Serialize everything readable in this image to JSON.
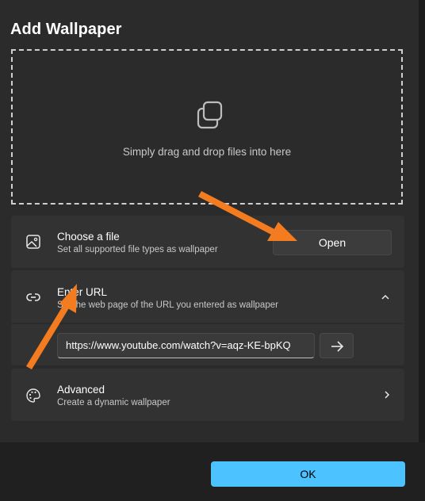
{
  "dialog": {
    "title": "Add Wallpaper",
    "dropzone_text": "Simply drag and drop files into here"
  },
  "choose_file": {
    "title": "Choose a file",
    "subtitle": "Set all supported file types as wallpaper",
    "button_label": "Open",
    "icon": "image-icon"
  },
  "enter_url": {
    "title": "Enter URL",
    "subtitle": "Set the web page of the URL you entered as wallpaper",
    "expanded": true,
    "input_value": "https://www.youtube.com/watch?v=aqz-KE-bpKQ",
    "icon": "link-icon"
  },
  "advanced": {
    "title": "Advanced",
    "subtitle": "Create a dynamic wallpaper",
    "icon": "palette-icon"
  },
  "footer": {
    "ok_label": "OK"
  },
  "colors": {
    "accent": "#4cc2ff",
    "annotation_arrow": "#f47c20",
    "card_bg": "#323232",
    "dialog_bg": "#2b2b2b"
  }
}
